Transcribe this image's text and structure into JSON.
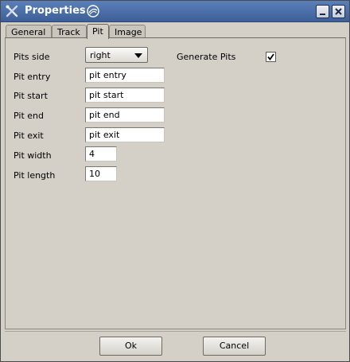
{
  "window": {
    "title": "Properties"
  },
  "tabs": [
    {
      "label": "General",
      "active": false
    },
    {
      "label": "Track",
      "active": false
    },
    {
      "label": "Pit",
      "active": true
    },
    {
      "label": "Image",
      "active": false
    }
  ],
  "pit": {
    "pits_side_label": "Pits side",
    "pits_side_value": "right",
    "generate_pits_label": "Generate Pits",
    "generate_pits_checked": true,
    "entry_label": "Pit entry",
    "entry_value": "pit entry",
    "start_label": "Pit start",
    "start_value": "pit start",
    "end_label": "Pit end",
    "end_value": "pit end",
    "exit_label": "Pit exit",
    "exit_value": "pit exit",
    "width_label": "Pit width",
    "width_value": "4",
    "length_label": "Pit length",
    "length_value": "10"
  },
  "buttons": {
    "ok_label": "Ok",
    "cancel_label": "Cancel"
  },
  "icons": {
    "app": "tools-x-icon",
    "title_ornament": "swirl-icon",
    "minimize": "minimize-icon",
    "close": "close-icon",
    "dropdown": "chevron-down-icon",
    "check": "checkmark-icon"
  },
  "colors": {
    "titlebar": "#4a6ea8",
    "background": "#d4d0c8"
  }
}
